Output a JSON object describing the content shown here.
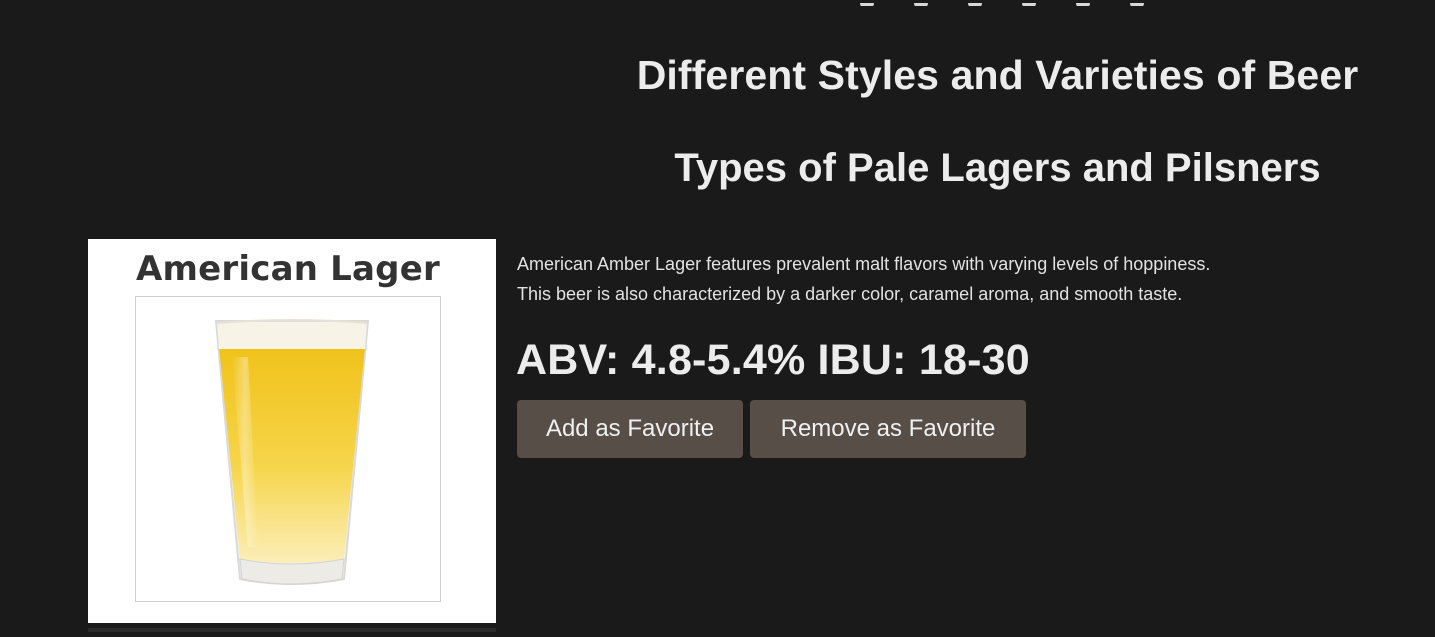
{
  "header": {
    "title": "Different Styles and Varieties of Beer",
    "subtitle": "Types of Pale Lagers and Pilsners"
  },
  "beer": {
    "image_caption": "American Lager",
    "description_line1": "American Amber Lager features prevalent malt flavors with varying levels of hoppiness.",
    "description_line2": "This beer is also characterized by a darker color, caramel aroma, and smooth taste.",
    "stats": "ABV: 4.8-5.4% IBU: 18-30"
  },
  "actions": {
    "add_label": "Add as Favorite",
    "remove_label": "Remove as Favorite"
  },
  "colors": {
    "background": "#1b1a1a",
    "button_bg": "#574e47",
    "beer_gold": "#f2c81c"
  },
  "icons": {
    "image": "beer-glass-icon"
  }
}
